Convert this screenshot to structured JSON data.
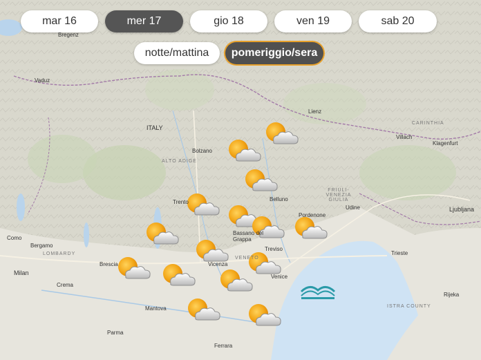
{
  "days": [
    {
      "label": "mar 16",
      "active": false
    },
    {
      "label": "mer 17",
      "active": true
    },
    {
      "label": "gio 18",
      "active": false
    },
    {
      "label": "ven 19",
      "active": false
    },
    {
      "label": "sab 20",
      "active": false
    }
  ],
  "periods": [
    {
      "label": "notte/mattina",
      "active": false
    },
    {
      "label": "pomeriggio/sera",
      "active": true
    }
  ],
  "map_labels": {
    "vaduz": "Vaduz",
    "bregenz": "Bregenz",
    "italy": "ITALY",
    "bolzano": "Bolzano",
    "alto_adige": "ALTO ADIGE",
    "trento": "Trento",
    "belluno": "Belluno",
    "udine": "Udine",
    "friuli": "FRIULI-VENEZIA GIULIA",
    "pordenone": "Pordenone",
    "lienz": "Lienz",
    "villach": "Villach",
    "klagenfurt": "Klagenfurt",
    "carinthia": "CARINTHIA",
    "ljubljana": "Ljubljana",
    "trieste": "Trieste",
    "bassano": "Bassano del Grappa",
    "treviso": "Treviso",
    "vicenza": "Vicenza",
    "venezia": "Venice",
    "milan": "Milan",
    "bergamo": "Bergamo",
    "brescia": "Brescia",
    "como": "Como",
    "lombardy": "LOMBARDY",
    "crema": "Crema",
    "mantova": "Mantova",
    "parma": "Parma",
    "ferrara": "Ferrara",
    "rijeka": "Rijeka",
    "istra": "ISTRA COUNTY",
    "veneto": "VENETO"
  },
  "weather_icons": [
    {
      "name": "partly-cloudy-sun-icon"
    }
  ],
  "colors": {
    "sun": "#f2a516",
    "cloud": "#cfcfcf",
    "sea": "#cfe3f4",
    "active_pill": "#555555",
    "active_border": "#e8a12b"
  }
}
